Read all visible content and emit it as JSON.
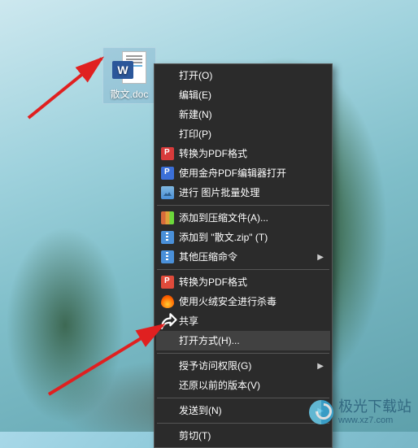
{
  "file": {
    "label": "散文.doc",
    "badge": "W"
  },
  "menu": {
    "items": [
      {
        "label": "打开(O)",
        "icon": null,
        "sub": false,
        "sep_after": false
      },
      {
        "label": "编辑(E)",
        "icon": null,
        "sub": false,
        "sep_after": false
      },
      {
        "label": "新建(N)",
        "icon": null,
        "sub": false,
        "sep_after": false
      },
      {
        "label": "打印(P)",
        "icon": null,
        "sub": false,
        "sep_after": false
      },
      {
        "label": "转换为PDF格式",
        "icon": "pdf-red",
        "sub": false,
        "sep_after": false
      },
      {
        "label": "使用金舟PDF编辑器打开",
        "icon": "pdf-blue",
        "sub": false,
        "sep_after": false
      },
      {
        "label": "进行 图片批量处理",
        "icon": "img",
        "sub": false,
        "sep_after": true
      },
      {
        "label": "添加到压缩文件(A)...",
        "icon": "books",
        "sub": false,
        "sep_after": false
      },
      {
        "label": "添加到 \"散文.zip\" (T)",
        "icon": "zip",
        "sub": false,
        "sep_after": false
      },
      {
        "label": "其他压缩命令",
        "icon": "zip2",
        "sub": true,
        "sep_after": true
      },
      {
        "label": "转换为PDF格式",
        "icon": "p",
        "sub": false,
        "sep_after": false
      },
      {
        "label": "使用火绒安全进行杀毒",
        "icon": "flame",
        "sub": false,
        "sep_after": false
      },
      {
        "label": "共享",
        "icon": "share",
        "sub": false,
        "sep_after": false
      },
      {
        "label": "打开方式(H)...",
        "icon": null,
        "sub": false,
        "sep_after": true,
        "highlight": true
      },
      {
        "label": "授予访问权限(G)",
        "icon": null,
        "sub": true,
        "sep_after": false
      },
      {
        "label": "还原以前的版本(V)",
        "icon": null,
        "sub": false,
        "sep_after": true
      },
      {
        "label": "发送到(N)",
        "icon": null,
        "sub": true,
        "sep_after": true
      },
      {
        "label": "剪切(T)",
        "icon": null,
        "sub": false,
        "sep_after": false
      }
    ]
  },
  "watermark": {
    "title": "极光下载站",
    "url": "www.xz7.com"
  }
}
